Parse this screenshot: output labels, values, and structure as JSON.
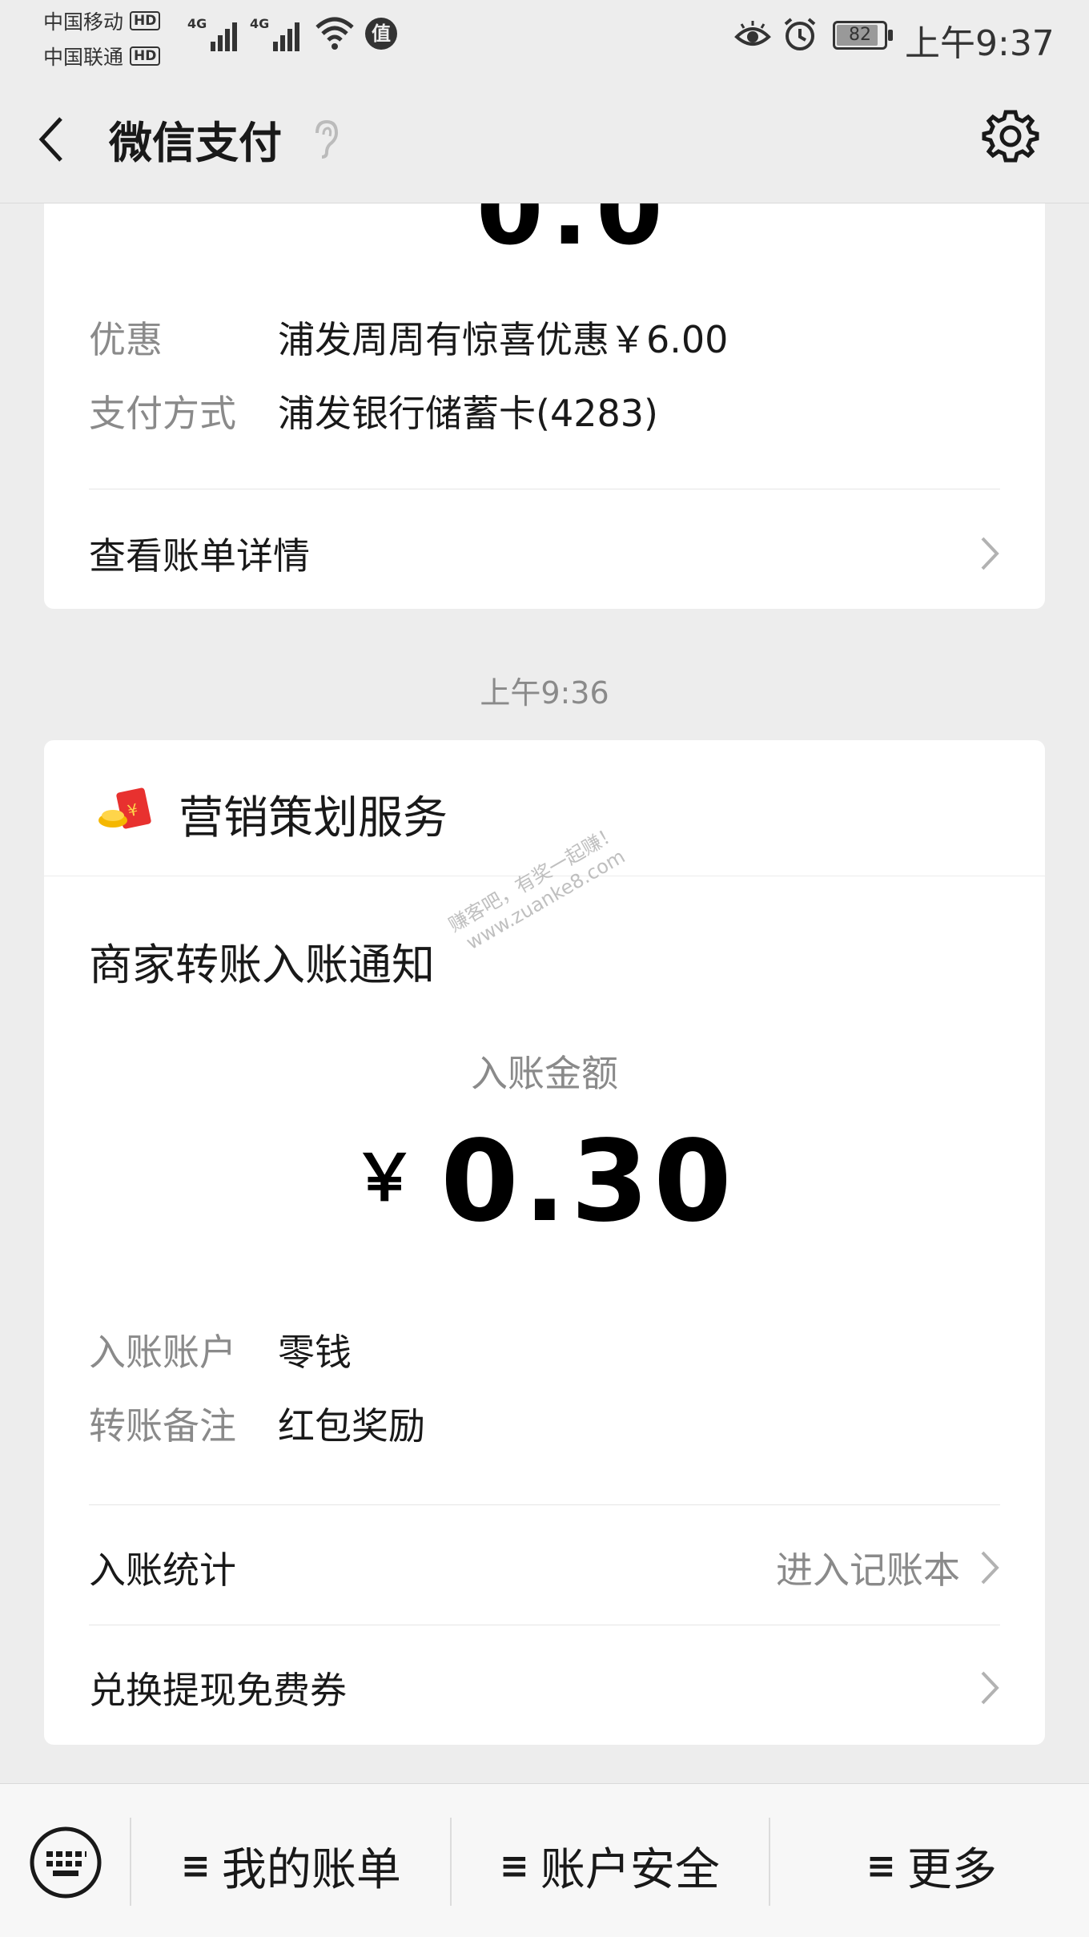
{
  "status": {
    "carrier1": "中国移动",
    "carrier2": "中国联通",
    "hd": "HD",
    "net": "4G",
    "app_badge": "值",
    "battery": "82",
    "time": "上午9:37"
  },
  "nav": {
    "title": "微信支付"
  },
  "card1": {
    "discount_label": "优惠",
    "discount_value": "浦发周周有惊喜优惠￥6.00",
    "method_label": "支付方式",
    "method_value": "浦发银行储蓄卡(4283)",
    "detail_link": "查看账单详情"
  },
  "time_separator": "上午9:36",
  "card2": {
    "service_name": "营销策划服务",
    "notice_title": "商家转账入账通知",
    "watermark_line1": "赚客吧，有奖一起赚！",
    "watermark_line2": "www.zuanke8.com",
    "amount_label": "入账金额",
    "currency": "￥",
    "amount": "0.30",
    "account_label": "入账账户",
    "account_value": "零钱",
    "note_label": "转账备注",
    "note_value": "红包奖励",
    "stats_label": "入账统计",
    "stats_link": "进入记账本",
    "coupon_label": "兑换提现免费券"
  },
  "bottom": {
    "ham": "≡",
    "bill": "我的账单",
    "security": "账户安全",
    "more": "更多"
  }
}
